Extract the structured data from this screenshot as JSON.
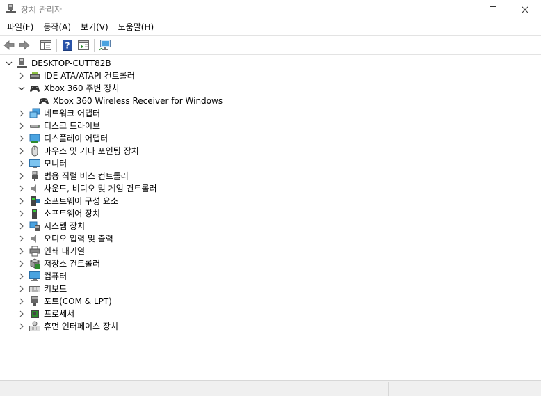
{
  "window": {
    "title": "장치 관리자"
  },
  "menu": {
    "file": "파일(F)",
    "action": "동작(A)",
    "view": "보기(V)",
    "help": "도움말(H)"
  },
  "tree": {
    "root": "DESKTOP-CUTT82B",
    "ide": "IDE ATA/ATAPI 컨트롤러",
    "xbox": "Xbox 360 주변 장치",
    "xbox_receiver": "Xbox 360 Wireless Receiver for Windows",
    "network": "네트워크 어댑터",
    "disk": "디스크 드라이브",
    "display": "디스플레이 어댑터",
    "mouse": "마우스 및 기타 포인팅 장치",
    "monitor": "모니터",
    "usb": "범용 직렬 버스 컨트롤러",
    "sound": "사운드, 비디오 및 게임 컨트롤러",
    "software_component": "소프트웨어 구성 요소",
    "software_device": "소프트웨어 장치",
    "system": "시스템 장치",
    "audio_io": "오디오 입력 및 출력",
    "print_queue": "인쇄 대기열",
    "storage": "저장소 컨트롤러",
    "computer": "컴퓨터",
    "keyboard": "키보드",
    "ports": "포트(COM & LPT)",
    "processor": "프로세서",
    "hid": "휴먼 인터페이스 장치"
  }
}
